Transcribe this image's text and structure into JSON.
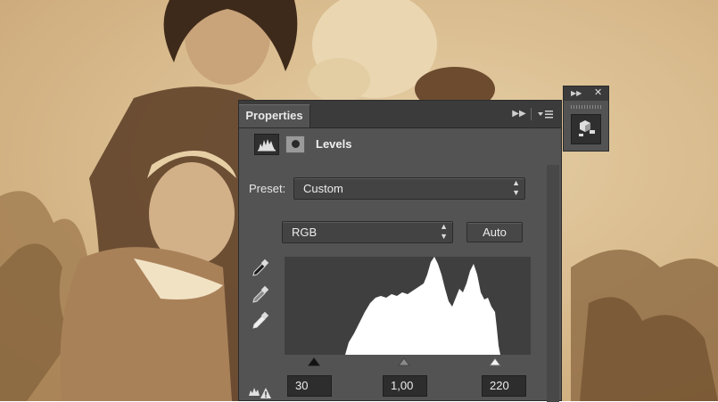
{
  "panel": {
    "tab_label": "Properties",
    "expand_icon": "double-chevron-right-icon",
    "menu_icon": "panel-menu-icon"
  },
  "adjustment": {
    "title": "Levels",
    "icons": [
      "levels-histogram-icon",
      "layer-mask-icon"
    ]
  },
  "preset": {
    "label": "Preset:",
    "value": "Custom"
  },
  "channel": {
    "value": "RGB",
    "auto_label": "Auto"
  },
  "eyedroppers": [
    "black-point-eyedropper-icon",
    "gray-point-eyedropper-icon",
    "white-point-eyedropper-icon"
  ],
  "levels": {
    "black_input": "30",
    "gamma": "1,00",
    "white_input": "220"
  },
  "mini_panel": {
    "icons": [
      "double-chevron-right-icon",
      "close-icon",
      "3d-object-icon"
    ],
    "close_label": "✕"
  },
  "colors": {
    "panel_bg": "#535353",
    "header_bg": "#3b3b3b",
    "histogram_fill": "#ffffff",
    "histogram_bg": "#3f3f3f"
  }
}
